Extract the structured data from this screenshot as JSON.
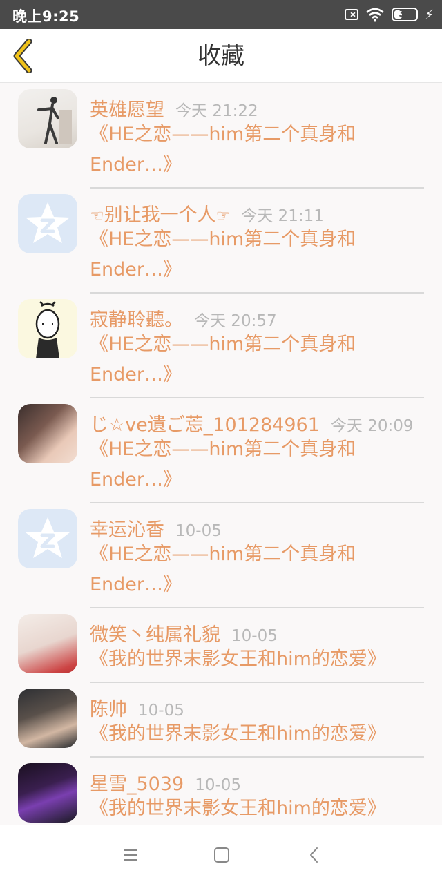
{
  "status_bar": {
    "time": "晚上9:25",
    "battery_level": "35",
    "battery_percent": 35
  },
  "header": {
    "title": "收藏",
    "back_icon": "chevron-left-icon"
  },
  "colors": {
    "accent": "#e79a66",
    "time": "#b8b8b8",
    "back_icon": "#f0c21a"
  },
  "items": [
    {
      "name": "英雄愿望",
      "time": "今天 21:22",
      "line1": "《HE之恋——him第二个真身和",
      "line2": "Ender…》",
      "avatar": "photo"
    },
    {
      "name_prefix": "☜",
      "name": "别让我一个人",
      "name_suffix": "☞",
      "time": "今天 21:11",
      "line1": "《HE之恋——him第二个真身和",
      "line2": "Ender…》",
      "avatar": "qq-default-icon"
    },
    {
      "name": "寂静聆聽。",
      "time": "今天 20:57",
      "line1": "《HE之恋——him第二个真身和",
      "line2": "Ender…》",
      "avatar": "drawing"
    },
    {
      "name": "じ☆ve遺ご莣_101284961",
      "time": "今天 20:09",
      "line1": "《HE之恋——him第二个真身和",
      "line2": "Ender…》",
      "avatar": "photo"
    },
    {
      "name": "幸运沁香",
      "time": "10-05",
      "line1": "《HE之恋——him第二个真身和",
      "line2": "Ender…》",
      "avatar": "qq-default-icon"
    },
    {
      "name": "微笑丶纯属礼貌",
      "time": "10-05",
      "line1": "《我的世界末影女王和him的恋爱》",
      "avatar": "photo"
    },
    {
      "name": "陈帅",
      "time": "10-05",
      "line1": "《我的世界末影女王和him的恋爱》",
      "avatar": "photo"
    },
    {
      "name": "星雪_5039",
      "time": "10-05",
      "line1": "《我的世界末影女王和him的恋爱》",
      "avatar": "photo"
    }
  ],
  "system_nav": {
    "menu_icon": "menu-icon",
    "home_icon": "home-square-icon",
    "back_icon": "back-triangle-icon"
  }
}
